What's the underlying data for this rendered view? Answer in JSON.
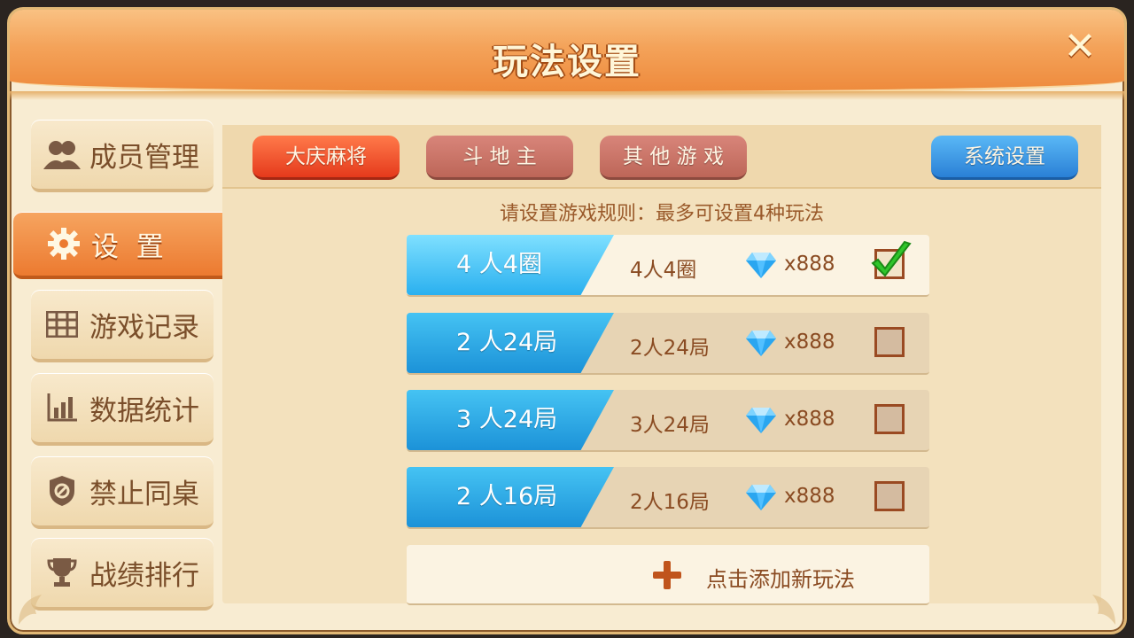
{
  "title": "玩法设置",
  "close_label": "✕",
  "sidebar": {
    "items": [
      {
        "label": "成员管理",
        "icon": "members-icon"
      },
      {
        "label": "设  置",
        "icon": "gear-icon"
      },
      {
        "label": "游戏记录",
        "icon": "table-icon"
      },
      {
        "label": "数据统计",
        "icon": "bar-chart-icon"
      },
      {
        "label": "禁止同桌",
        "icon": "shield-forbid-icon"
      },
      {
        "label": "战绩排行",
        "icon": "trophy-icon"
      }
    ],
    "active_index": 1
  },
  "tabs": [
    {
      "label": "大庆麻将",
      "style": "red"
    },
    {
      "label": "斗 地 主",
      "style": "muted"
    },
    {
      "label": "其 他 游 戏",
      "style": "muted"
    },
    {
      "label": "系统设置",
      "style": "blue"
    }
  ],
  "hint": "请设置游戏规则：最多可设置4种玩法",
  "rules": [
    {
      "label": "4 人4圈",
      "desc": "4人4圈",
      "cost": "x888",
      "checked": true
    },
    {
      "label": "2 人24局",
      "desc": "2人24局",
      "cost": "x888",
      "checked": false
    },
    {
      "label": "3 人24局",
      "desc": "3人24局",
      "cost": "x888",
      "checked": false
    },
    {
      "label": "2 人16局",
      "desc": "2人16局",
      "cost": "x888",
      "checked": false
    }
  ],
  "add_rule_label": "点击添加新玩法",
  "colors": {
    "accent_orange": "#ee8a3c",
    "row_blue": "#1c92d8",
    "check_green": "#2fc52a",
    "text_brown": "#8a4b22"
  }
}
